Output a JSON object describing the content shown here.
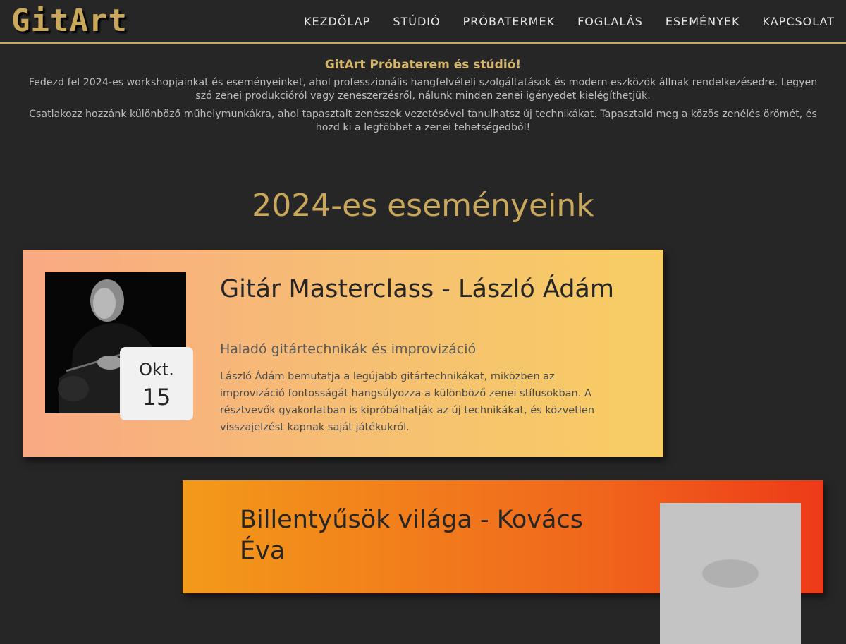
{
  "header": {
    "logo": "GitArt",
    "nav": [
      "KEZDŐLAP",
      "STÚDIÓ",
      "PRÓBATERMEK",
      "FOGLALÁS",
      "ESEMÉNYEK",
      "KAPCSOLAT"
    ]
  },
  "intro": {
    "title": "GitArt Próbaterem és stúdió!",
    "p1": "Fedezd fel 2024-es workshopjainkat és eseményeinket, ahol professzionális hangfelvételi szolgáltatások és modern eszközök állnak rendelkezésedre. Legyen szó zenei produkcióról vagy zeneszerzésről, nálunk minden zenei igényedet kielégíthetjük.",
    "p2": "Csatlakozz hozzánk különböző műhelymunkákra, ahol tapasztalt zenészek vezetésével tanulhatsz új technikákat. Tapasztald meg a közös zenélés örömét, és hozd ki a legtöbbet a zenei tehetségedből!"
  },
  "events": {
    "heading": "2024-es eseményeink",
    "items": [
      {
        "month": "Okt.",
        "day": "15",
        "title": "Gitár Masterclass - László Ádám",
        "subtitle": "Haladó gitártechnikák és improvizáció",
        "description": "László Ádám bemutatja a legújabb gitártechnikákat, miközben az improvizáció fontosságát hangsúlyozza a különböző zenei stílusokban. A résztvevők gyakorlatban is kipróbálhatják az új technikákat, és közvetlen visszajelzést kapnak saját játékukról."
      },
      {
        "title": "Billentyűsök világa - Kovács Éva"
      }
    ]
  },
  "colors": {
    "background": "#262626",
    "accent": "#c9a85c",
    "nav_text": "#e8e8e8"
  }
}
